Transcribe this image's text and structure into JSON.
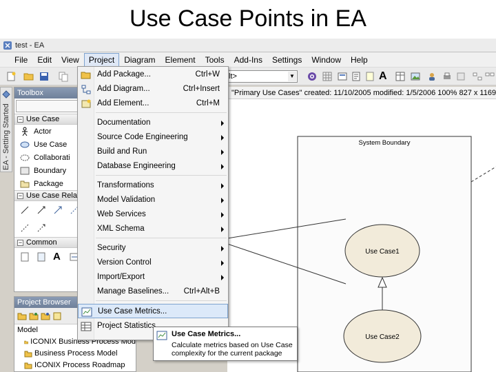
{
  "slide": {
    "title": "Use Case Points in EA"
  },
  "window": {
    "title": "test - EA"
  },
  "menu": {
    "items": [
      "File",
      "Edit",
      "View",
      "Project",
      "Diagram",
      "Element",
      "Tools",
      "Add-Ins",
      "Settings",
      "Window",
      "Help"
    ],
    "open_item": "Project"
  },
  "toolbar": {
    "diagram_combo": "lt>"
  },
  "side_tab": {
    "label": "EA - Setting Started"
  },
  "toolbox": {
    "title": "Toolbox",
    "sections": [
      {
        "name": "Use Case",
        "items": [
          "Actor",
          "Use Case",
          "Collaborati",
          "Boundary",
          "Package"
        ]
      },
      {
        "name": "Use Case Relat"
      },
      {
        "name": "Common"
      }
    ]
  },
  "project_browser": {
    "title": "Project Browser",
    "root": "Model",
    "rows": [
      "ICONIX Business Process Mod",
      "Business Process Model",
      "ICONIX Process Roadmap"
    ]
  },
  "diagram_header": {
    "text": "\"Primary Use Cases\"  created: 11/10/2005  modified: 1/5/2006  100%  827 x 1169"
  },
  "diagram": {
    "boundary_label": "System Boundary",
    "use_cases": [
      "Use Case1",
      "Use Case2"
    ]
  },
  "project_menu": {
    "items": [
      {
        "label": "Add Package...",
        "shortcut": "Ctrl+W",
        "icon": "package-icon"
      },
      {
        "label": "Add Diagram...",
        "shortcut": "Ctrl+Insert",
        "icon": "diagram-icon"
      },
      {
        "label": "Add Element...",
        "shortcut": "Ctrl+M",
        "icon": "element-icon"
      },
      {
        "label": "Documentation",
        "submenu": true
      },
      {
        "label": "Source Code Engineering",
        "submenu": true
      },
      {
        "label": "Build and Run",
        "submenu": true
      },
      {
        "label": "Database Engineering",
        "submenu": true
      },
      {
        "label": "Transformations",
        "submenu": true
      },
      {
        "label": "Model Validation",
        "submenu": true
      },
      {
        "label": "Web Services",
        "submenu": true
      },
      {
        "label": "XML Schema",
        "submenu": true
      },
      {
        "label": "Security",
        "submenu": true
      },
      {
        "label": "Version Control",
        "submenu": true
      },
      {
        "label": "Import/Export",
        "submenu": true
      },
      {
        "label": "Manage Baselines...",
        "shortcut": "Ctrl+Alt+B"
      },
      {
        "label": "Use Case Metrics...",
        "icon": "metrics-icon",
        "highlighted": true
      },
      {
        "label": "Project Statistics...",
        "icon": "statistics-icon"
      }
    ]
  },
  "tooltip": {
    "title": "Use Case Metrics...",
    "body": "Calculate metrics based on Use Case complexity for the current package"
  }
}
